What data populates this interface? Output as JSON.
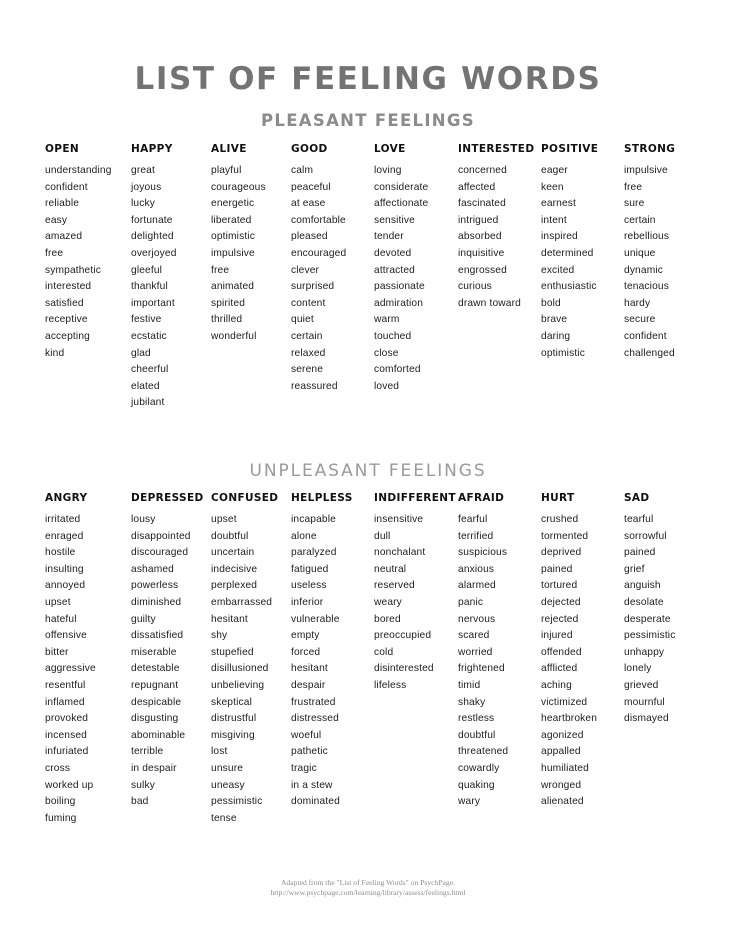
{
  "document": {
    "title": "LIST OF FEELING WORDS",
    "title_color": "#737373"
  },
  "sections": [
    {
      "id": "pleasant",
      "heading": "PLEASANT FEELINGS",
      "columns": [
        {
          "header": "OPEN",
          "words": [
            "understanding",
            "confident",
            "reliable",
            "easy",
            "amazed",
            "free",
            "sympathetic",
            "interested",
            "satisfied",
            "receptive",
            "accepting",
            "kind"
          ]
        },
        {
          "header": "HAPPY",
          "words": [
            "great",
            "joyous",
            "lucky",
            "fortunate",
            "delighted",
            "overjoyed",
            "gleeful",
            "thankful",
            "important",
            "festive",
            "ecstatic",
            "glad",
            "cheerful",
            "elated",
            "jubilant"
          ]
        },
        {
          "header": "ALIVE",
          "words": [
            "playful",
            "courageous",
            "energetic",
            "liberated",
            "optimistic",
            "impulsive",
            "free",
            "animated",
            "spirited",
            "thrilled",
            "wonderful"
          ]
        },
        {
          "header": "GOOD",
          "words": [
            "calm",
            "peaceful",
            "at ease",
            "comfortable",
            "pleased",
            "encouraged",
            "clever",
            "surprised",
            "content",
            "quiet",
            "certain",
            "relaxed",
            "serene",
            "reassured"
          ]
        },
        {
          "header": "LOVE",
          "words": [
            "loving",
            "considerate",
            "affectionate",
            "sensitive",
            "tender",
            "devoted",
            "attracted",
            "passionate",
            "admiration",
            "warm",
            "touched",
            "close",
            "comforted",
            "loved"
          ]
        },
        {
          "header": "INTERESTED",
          "words": [
            "concerned",
            "affected",
            "fascinated",
            "intrigued",
            "absorbed",
            "inquisitive",
            "engrossed",
            "curious",
            "drawn toward"
          ]
        },
        {
          "header": "POSITIVE",
          "words": [
            "eager",
            "keen",
            "earnest",
            "intent",
            "inspired",
            "determined",
            "excited",
            "enthusiastic",
            "bold",
            "brave",
            "daring",
            "optimistic"
          ]
        },
        {
          "header": "STRONG",
          "words": [
            "impulsive",
            "free",
            "sure",
            "certain",
            "rebellious",
            "unique",
            "dynamic",
            "tenacious",
            "hardy",
            "secure",
            "confident",
            "challenged"
          ]
        }
      ]
    },
    {
      "id": "unpleasant",
      "heading": "UNPLEASANT FEELINGS",
      "columns": [
        {
          "header": "ANGRY",
          "words": [
            "irritated",
            "enraged",
            "hostile",
            "insulting",
            "annoyed",
            "upset",
            "hateful",
            "offensive",
            "bitter",
            "aggressive",
            "resentful",
            "inflamed",
            "provoked",
            "incensed",
            "infuriated",
            "cross",
            "worked up",
            "boiling",
            "fuming"
          ]
        },
        {
          "header": "DEPRESSED",
          "words": [
            "lousy",
            "disappointed",
            "discouraged",
            "ashamed",
            "powerless",
            "diminished",
            "guilty",
            "dissatisfied",
            "miserable",
            "detestable",
            "repugnant",
            "despicable",
            "disgusting",
            "abominable",
            "terrible",
            "in despair",
            "sulky",
            "bad"
          ]
        },
        {
          "header": "CONFUSED",
          "words": [
            "upset",
            "doubtful",
            "uncertain",
            "indecisive",
            "perplexed",
            "embarrassed",
            "hesitant",
            "shy",
            "stupefied",
            "disillusioned",
            "unbelieving",
            "skeptical",
            "distrustful",
            "misgiving",
            "lost",
            "unsure",
            "uneasy",
            "pessimistic",
            "tense"
          ]
        },
        {
          "header": "HELPLESS",
          "words": [
            "incapable",
            "alone",
            "paralyzed",
            "fatigued",
            "useless",
            "inferior",
            "vulnerable",
            "empty",
            "forced",
            "hesitant",
            "despair",
            "frustrated",
            "distressed",
            "woeful",
            "pathetic",
            "tragic",
            "in a stew",
            "dominated"
          ]
        },
        {
          "header": "INDIFFERENT",
          "words": [
            "insensitive",
            "dull",
            "nonchalant",
            "neutral",
            "reserved",
            "weary",
            "bored",
            "preoccupied",
            "cold",
            "disinterested",
            "lifeless"
          ]
        },
        {
          "header": "AFRAID",
          "words": [
            "fearful",
            "terrified",
            "suspicious",
            "anxious",
            "alarmed",
            "panic",
            "nervous",
            "scared",
            "worried",
            "frightened",
            "timid",
            "shaky",
            "restless",
            "doubtful",
            "threatened",
            "cowardly",
            "quaking",
            "wary"
          ]
        },
        {
          "header": "HURT",
          "words": [
            "crushed",
            "tormented",
            "deprived",
            "pained",
            "tortured",
            "dejected",
            "rejected",
            "injured",
            "offended",
            "afflicted",
            "aching",
            "victimized",
            "heartbroken",
            "agonized",
            "appalled",
            "humiliated",
            "wronged",
            "alienated"
          ]
        },
        {
          "header": "SAD",
          "words": [
            "tearful",
            "sorrowful",
            "pained",
            "grief",
            "anguish",
            "desolate",
            "desperate",
            "pessimistic",
            "unhappy",
            "lonely",
            "grieved",
            "mournful",
            "dismayed"
          ]
        }
      ]
    }
  ],
  "footer": {
    "line1": "Adapted from the \"List of Feeling Words\" on PsychPage.",
    "line2": "http://www.psychpage.com/learning/library/assess/feelings.html"
  }
}
